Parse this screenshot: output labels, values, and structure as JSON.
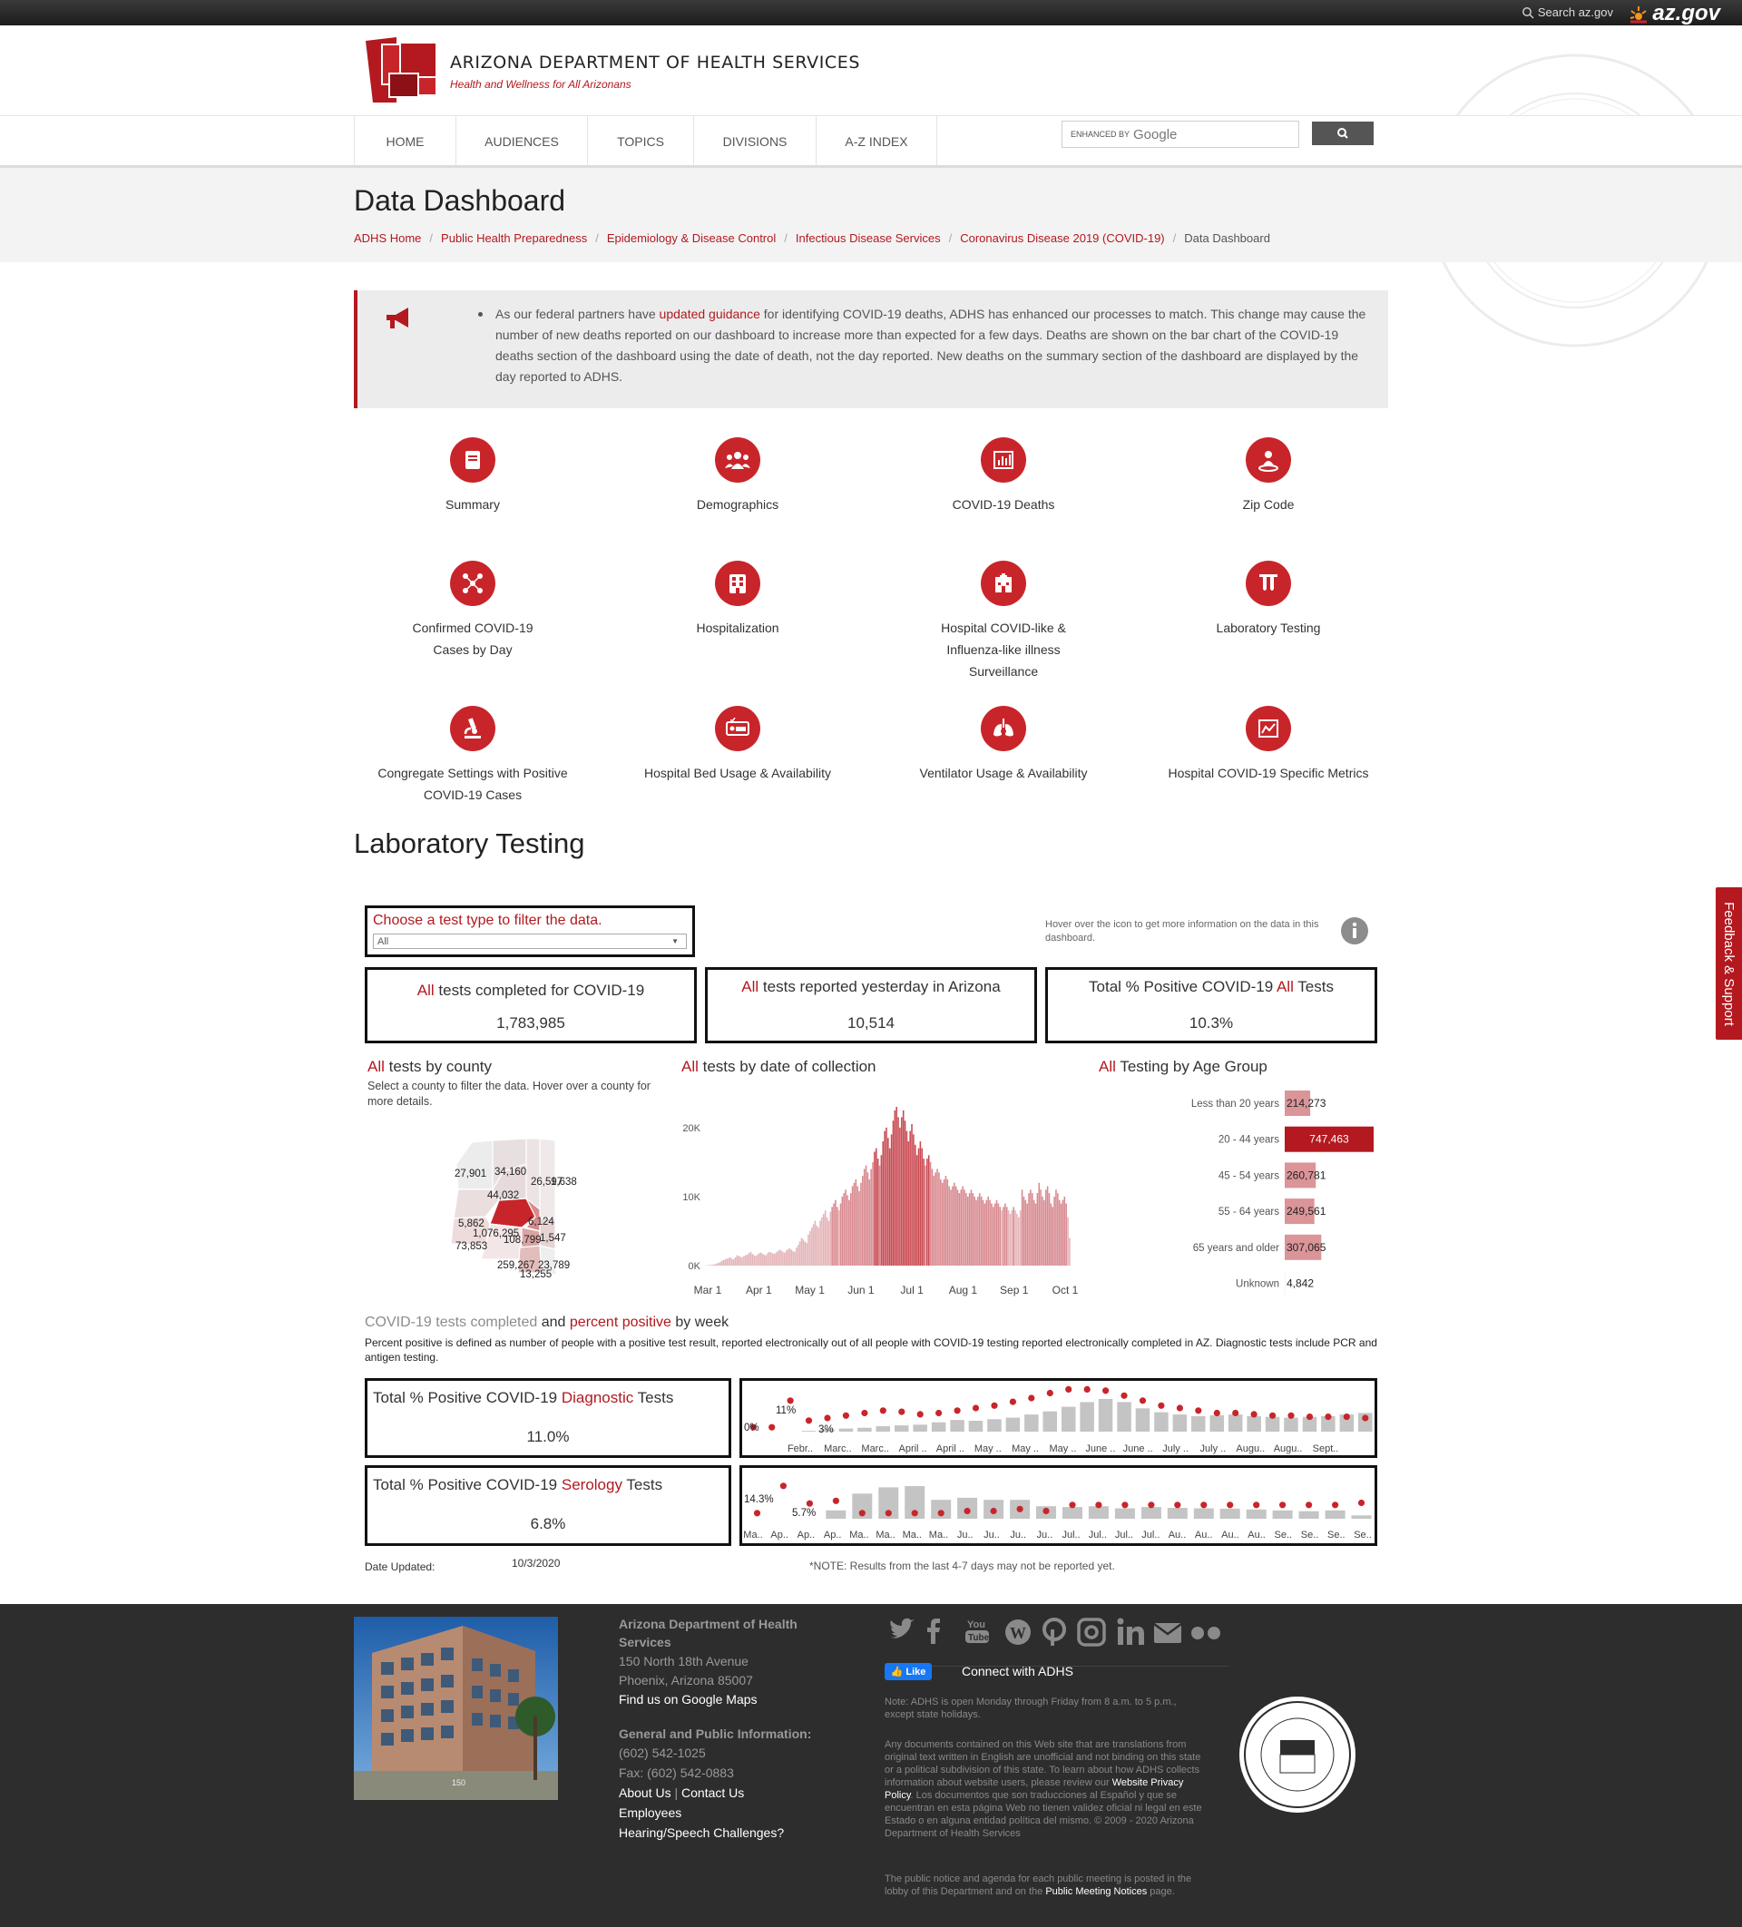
{
  "topbar": {
    "search_label": "Search az.gov",
    "azgov_label": "az.gov"
  },
  "header": {
    "org_name": "ARIZONA DEPARTMENT OF HEALTH SERVICES",
    "tagline": "Health and Wellness for All Arizonans"
  },
  "nav": {
    "items": [
      "HOME",
      "AUDIENCES",
      "TOPICS",
      "DIVISIONS",
      "A-Z INDEX"
    ],
    "search_prefix": "ENHANCED BY",
    "search_brand": "Google"
  },
  "page": {
    "title": "Data Dashboard",
    "breadcrumb": [
      "ADHS Home",
      "Public Health Preparedness",
      "Epidemiology & Disease Control",
      "Infectious Disease Services",
      "Coronavirus Disease 2019 (COVID-19)",
      "Data Dashboard"
    ]
  },
  "alert": {
    "text_before": "As our federal partners have ",
    "link": "updated guidance",
    "text_after": " for identifying COVID-19 deaths, ADHS has enhanced our processes to match. This change may cause the number of new deaths reported on our dashboard to increase more than expected for a few days. Deaths are shown on the bar chart of the COVID-19 deaths section of the dashboard using the date of death, not the day reported. New deaths on the summary section of the dashboard are displayed by the day reported to ADHS."
  },
  "tiles": [
    {
      "label": "Summary",
      "icon": "book-icon"
    },
    {
      "label": "Demographics",
      "icon": "people-icon"
    },
    {
      "label": "COVID-19 Deaths",
      "icon": "bar-chart-icon"
    },
    {
      "label": "Zip Code",
      "icon": "location-person-icon"
    },
    {
      "label": "Confirmed COVID-19 Cases by Day",
      "icon": "network-icon"
    },
    {
      "label": "Hospitalization",
      "icon": "hospital-building-icon"
    },
    {
      "label": "Hospital COVID-like & Influenza-like illness Surveillance",
      "icon": "clinic-icon"
    },
    {
      "label": "Laboratory Testing",
      "icon": "test-tubes-icon"
    },
    {
      "label": "Congregate Settings with Positive COVID-19 Cases",
      "icon": "microscope-icon"
    },
    {
      "label": "Hospital Bed Usage & Availability",
      "icon": "hospital-bed-icon"
    },
    {
      "label": "Ventilator Usage & Availability",
      "icon": "lungs-icon"
    },
    {
      "label": "Hospital COVID-19 Specific Metrics",
      "icon": "line-chart-icon"
    }
  ],
  "lab": {
    "section_title": "Laboratory Testing",
    "filter_title": "Choose a test type to filter the data.",
    "filter_value": "All",
    "info_note": "Hover over the icon to get more information on the data in this dashboard.",
    "kpi1": {
      "prefix": "All",
      "label": " tests completed for COVID-19",
      "value": "1,783,985"
    },
    "kpi2": {
      "prefix": "All",
      "label": " tests reported yesterday in Arizona",
      "value": "10,514"
    },
    "kpi3": {
      "label_before": "Total % Positive COVID-19 ",
      "prefix": "All",
      "label_after": " Tests",
      "value": "10.3%"
    },
    "county_title_prefix": "All",
    "county_title": " tests by county",
    "county_note": "Select a county to filter the data. Hover over a county for more details.",
    "county_labels": [
      "27,901",
      "34,160",
      "26,597",
      "1,638",
      "44,032",
      "5,862",
      "6,124",
      "1,076,295",
      "108,799",
      "1,547",
      "73,853",
      "259,267",
      "23,789",
      "13,255"
    ],
    "date_title_prefix": "All",
    "date_title": " tests by date of collection",
    "age_title_prefix": "All",
    "age_title": " Testing by Age Group",
    "weekly_title_a": "COVID-19 tests completed",
    "weekly_title_b": " and ",
    "weekly_title_c": "percent positive",
    "weekly_title_d": " by week",
    "weekly_note": "Percent positive is defined as number of people with a positive test result, reported electronically out of all people with COVID-19 testing reported electronically completed in AZ. Diagnostic tests include PCR and antigen testing.",
    "diag": {
      "label_before": "Total % Positive COVID-19 ",
      "type": "Diagnostic",
      "label_after": " Tests",
      "value": "11.0%"
    },
    "sero": {
      "label_before": "Total % Positive COVID-19 ",
      "type": "Serology",
      "label_after": " Tests",
      "value": "6.8%"
    },
    "date_updated_label": "Date Updated:",
    "date_updated": "10/3/2020",
    "note": "*NOTE: Results from the last 4-7 days may not be reported yet."
  },
  "chart_data": [
    {
      "type": "bar",
      "title": "All tests by date of collection",
      "x_ticks": [
        "Mar 1",
        "Apr 1",
        "May 1",
        "Jun 1",
        "Jul 1",
        "Aug 1",
        "Sep 1",
        "Oct 1"
      ],
      "y_ticks": [
        "0K",
        "10K",
        "20K"
      ],
      "ylim": [
        0,
        23000
      ],
      "values": [
        50,
        60,
        80,
        100,
        150,
        200,
        300,
        400,
        500,
        700,
        800,
        900,
        1000,
        1100,
        1200,
        1000,
        900,
        1200,
        1500,
        1400,
        1300,
        1200,
        1400,
        1500,
        1600,
        1800,
        2000,
        1700,
        1500,
        1400,
        1600,
        1800,
        1900,
        1700,
        1600,
        1500,
        1800,
        2000,
        1900,
        1800,
        1700,
        1900,
        2100,
        2300,
        2200,
        2000,
        1900,
        2200,
        2400,
        2500,
        2300,
        2100,
        2000,
        2600,
        3000,
        3500,
        4000,
        3800,
        3500,
        3300,
        4500,
        5000,
        5500,
        6000,
        6500,
        5800,
        5500,
        6500,
        7000,
        7500,
        8000,
        7000,
        6500,
        7800,
        8500,
        9000,
        9500,
        8500,
        8000,
        9000,
        10000,
        10500,
        11000,
        10200,
        9500,
        10500,
        11500,
        12000,
        12500,
        11500,
        10800,
        12000,
        13000,
        14000,
        14500,
        13500,
        12500,
        14000,
        15000,
        16500,
        17000,
        15500,
        14500,
        16000,
        18000,
        19500,
        20000,
        18500,
        17000,
        19000,
        21000,
        22500,
        23000,
        21500,
        20000,
        21500,
        22500,
        21000,
        19500,
        18000,
        19500,
        20500,
        19000,
        17500,
        16000,
        17000,
        18000,
        17000,
        15500,
        14500,
        15500,
        16000,
        15000,
        14000,
        13000,
        13500,
        14000,
        13500,
        12500,
        12000,
        12500,
        13000,
        12500,
        11500,
        11000,
        11500,
        12000,
        11500,
        11000,
        10500,
        11000,
        11500,
        11000,
        10500,
        10000,
        10500,
        11000,
        10500,
        10000,
        9500,
        10000,
        10500,
        10000,
        9500,
        9000,
        9500,
        10000,
        9500,
        9000,
        8500,
        9000,
        9500,
        9000,
        8500,
        8000,
        8500,
        9000,
        8500,
        8000,
        7500,
        8000,
        8500,
        8000,
        7500,
        7000,
        8000,
        11000,
        10000,
        9500,
        9000,
        10500,
        11000,
        10500,
        9500,
        9000,
        10500,
        12000,
        11000,
        10000,
        9500,
        11000,
        11500,
        10500,
        9000,
        8500,
        10000,
        11000,
        10500,
        9500,
        9000,
        9500,
        10000,
        9000,
        7000,
        4000
      ]
    },
    {
      "type": "bar",
      "title": "All Testing by Age Group",
      "categories": [
        "Less than 20 years",
        "20 - 44 years",
        "45 - 54 years",
        "55 - 64 years",
        "65 years and older",
        "Unknown"
      ],
      "values": [
        214273,
        747463,
        260781,
        249561,
        307065,
        4842
      ],
      "value_labels": [
        "214,273",
        "747,463",
        "260,781",
        "249,561",
        "307,065",
        "4,842"
      ]
    },
    {
      "type": "bar",
      "title": "Total % Positive COVID-19 Diagnostic Tests",
      "x_ticks": [
        "Febr..",
        "Marc..",
        "Marc..",
        "April ..",
        "April ..",
        "May ..",
        "May ..",
        "May ..",
        "June ..",
        "June ..",
        "July ..",
        "July ..",
        "Augu..",
        "Augu..",
        "Sept.."
      ],
      "data_labels": [
        "0%",
        "11%",
        "3%"
      ],
      "tests": [
        0,
        0,
        0,
        1,
        3,
        4,
        5,
        7,
        8,
        9,
        12,
        15,
        14,
        16,
        18,
        22,
        26,
        32,
        38,
        42,
        38,
        30,
        25,
        22,
        20,
        21,
        22,
        20,
        19,
        18,
        19,
        20,
        22,
        24
      ],
      "percent_positive": [
        0.3,
        0.3,
        11,
        3,
        4,
        5,
        6,
        7,
        6.5,
        5.5,
        6,
        7,
        8,
        9,
        10.5,
        12,
        14,
        15.5,
        15.5,
        15,
        13,
        11,
        9,
        8,
        7,
        6,
        6,
        5.5,
        5,
        5,
        4.5,
        4.5,
        4.5,
        4
      ]
    },
    {
      "type": "bar",
      "title": "Total % Positive COVID-19 Serology Tests",
      "x_ticks": [
        "Ma..",
        "Ap..",
        "Ap..",
        "Ap..",
        "Ma..",
        "Ma..",
        "Ma..",
        "Ma..",
        "Ju..",
        "Ju..",
        "Ju..",
        "Ju..",
        "Jul..",
        "Jul..",
        "Jul..",
        "Jul..",
        "Au..",
        "Au..",
        "Au..",
        "Au..",
        "Se..",
        "Se..",
        "Se..",
        "Se.."
      ],
      "data_labels": [
        "14.3%",
        "5.7%"
      ],
      "tests": [
        0,
        0,
        0,
        20,
        60,
        75,
        78,
        45,
        50,
        45,
        45,
        30,
        28,
        30,
        25,
        28,
        26,
        25,
        24,
        22,
        20,
        18,
        20,
        8
      ],
      "percent_positive": [
        1,
        14.3,
        5.7,
        7,
        1,
        1,
        1,
        1,
        2,
        2,
        3,
        2,
        5,
        5,
        5,
        5,
        5,
        5,
        5,
        5,
        5,
        5,
        5,
        6
      ]
    }
  ],
  "footer": {
    "org": "Arizona Department of Health Services",
    "address1": "150 North 18th Avenue",
    "address2": "Phoenix, Arizona 85007",
    "maps_link": "Find us on Google Maps",
    "general_heading": "General and Public Information:",
    "phone": "(602) 542-1025",
    "fax": "Fax: (602) 542-0883",
    "about": "About Us",
    "contact": "Contact Us",
    "employees": "Employees",
    "hearing": "Hearing/Speech Challenges?",
    "like": "Like",
    "connect": "Connect with ADHS",
    "note_hours": "Note: ADHS is open Monday through Friday from 8 a.m. to 5 p.m., except state holidays.",
    "translation_before": "Any documents contained on this Web site that are translations from original text written in English are unofficial and not binding on this state or a political subdivision of this state. To learn about how ADHS collects information about website users, please review our ",
    "privacy_link": "Website Privacy Policy",
    "translation_after": ". Los documentos que son traducciones al Español y que se encuentran en esta página Web no tienen validez oficial ni legal en este Estado o en alguna entidad política del mismo. © 2009 - 2020 Arizona Department of Health Services",
    "meeting_before": "The public notice and agenda for each public meeting is posted in the lobby of this Department and on the ",
    "meeting_link": "Public Meeting Notices",
    "meeting_after": " page.",
    "building_number": "150"
  },
  "feedback_tab": "Feedback & Support",
  "colors": {
    "brand_red": "#b3191f",
    "bar_gray": "#c4c4c4",
    "dot_red": "#c8252b",
    "footer_bg": "#2d2d2d"
  }
}
